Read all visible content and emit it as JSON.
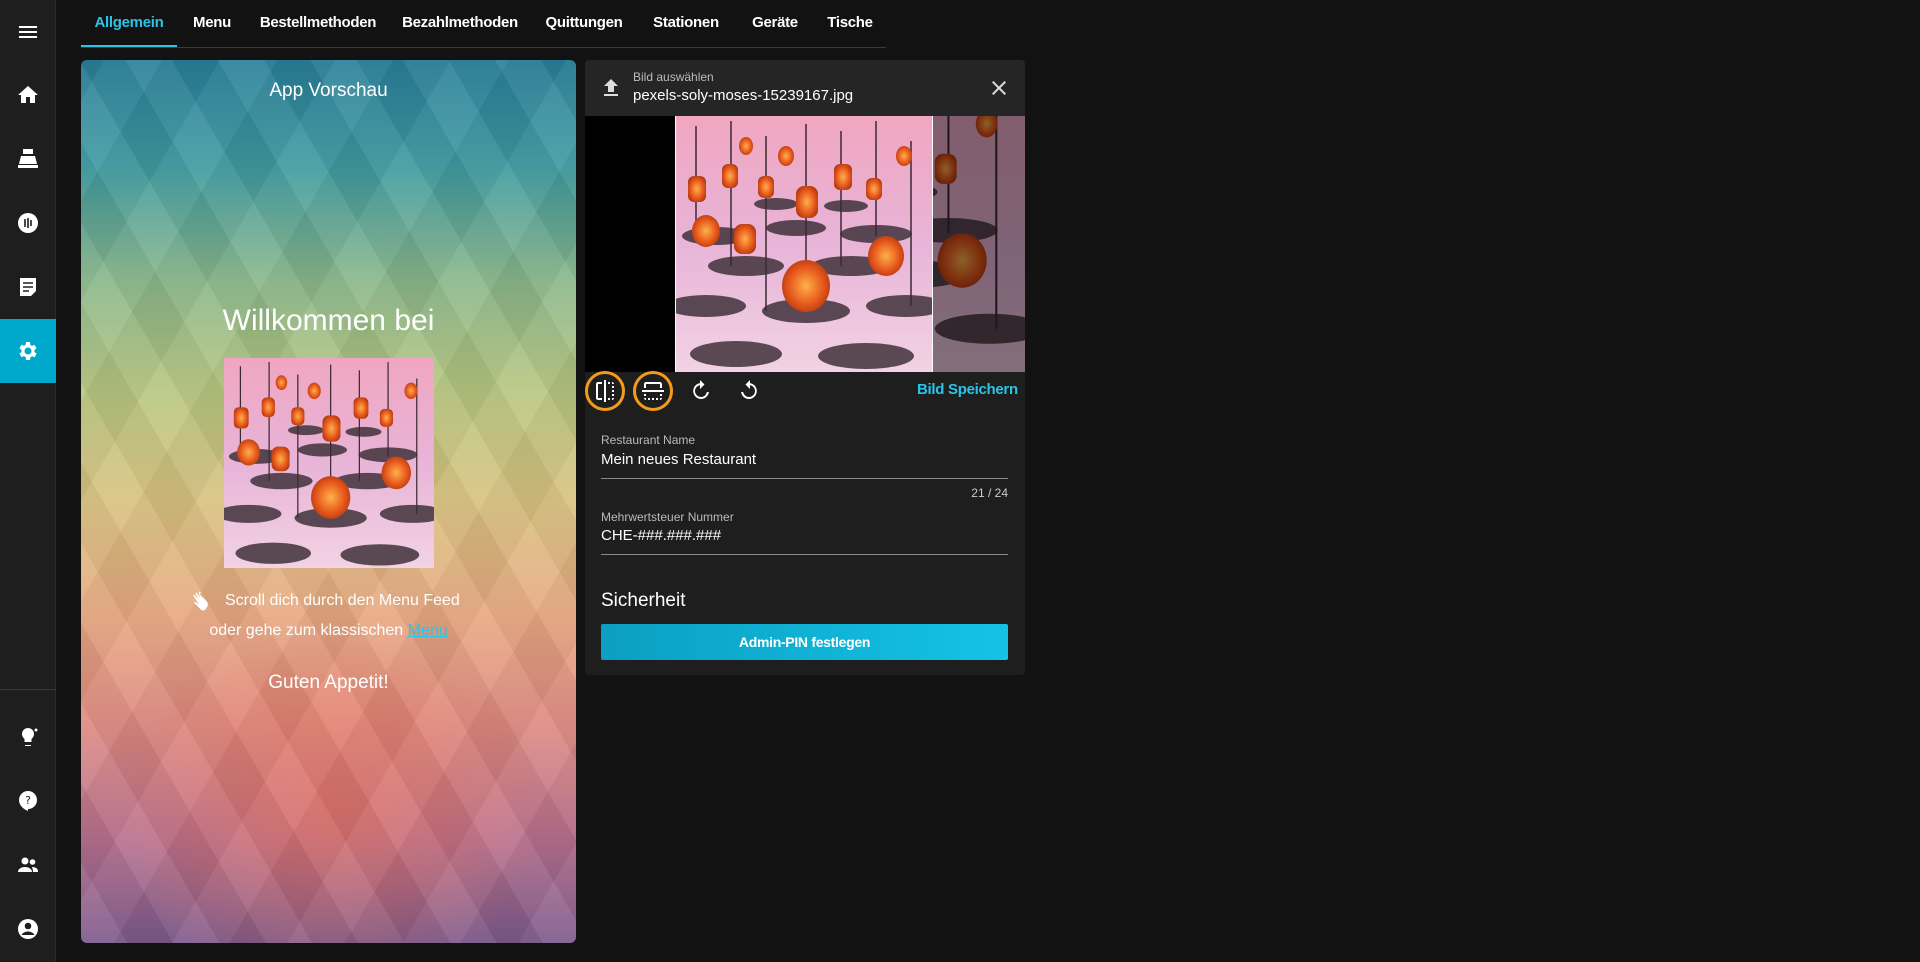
{
  "sidebar": {
    "items": [
      {
        "icon": "menu-icon"
      },
      {
        "icon": "home-icon"
      },
      {
        "icon": "cash-register-icon"
      },
      {
        "icon": "nfc-icon"
      },
      {
        "icon": "orders-icon"
      },
      {
        "icon": "settings-icon",
        "active": true
      },
      {
        "icon": "lightbulb-icon"
      },
      {
        "icon": "help-icon"
      },
      {
        "icon": "users-icon"
      },
      {
        "icon": "account-icon"
      }
    ]
  },
  "tabs": [
    "Allgemein",
    "Menu",
    "Bestellmethoden",
    "Bezahlmethoden",
    "Quittungen",
    "Stationen",
    "Geräte",
    "Tische"
  ],
  "active_tab": "Allgemein",
  "preview": {
    "title": "App Vorschau",
    "welcome": "Willkommen bei",
    "scroll_text": "Scroll dich durch den Menu Feed",
    "or_text": "oder gehe zum klassischen ",
    "menu_link": "Menu",
    "appetit": "Guten Appetit!"
  },
  "file": {
    "label": "Bild auswählen",
    "name": "pexels-soly-moses-15239167.jpg"
  },
  "image_tools": {
    "flip_horizontal": "flip-horizontal-icon",
    "flip_vertical": "flip-vertical-icon",
    "rotate_right": "rotate-right-icon",
    "rotate_left": "rotate-left-icon",
    "save_label": "Bild Speichern"
  },
  "form": {
    "restaurant_name": {
      "label": "Restaurant Name",
      "value": "Mein neues Restaurant",
      "counter": "21 / 24"
    },
    "vat_number": {
      "label": "Mehrwertsteuer Nummer",
      "value": "CHE-###.###.###"
    }
  },
  "security": {
    "title": "Sicherheit",
    "pin_button": "Admin-PIN festlegen"
  },
  "colors": {
    "accent": "#2bc4e8",
    "highlight": "#f39a1d",
    "background": "#121212",
    "panel": "#1e1e1e"
  }
}
